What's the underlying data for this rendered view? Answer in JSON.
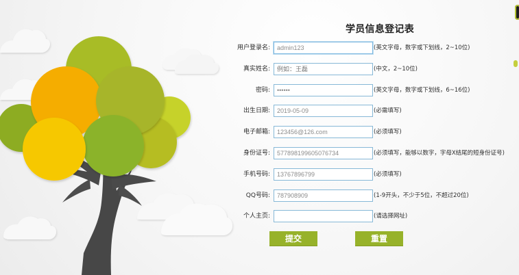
{
  "form": {
    "title": "学员信息登记表",
    "fields": [
      {
        "label": "用户登录名:",
        "value": "admin123",
        "placeholder": "",
        "hint": "(英文字母，数字或下划线，2~10位)",
        "active": true
      },
      {
        "label": "真实姓名:",
        "value": "",
        "placeholder": "例如：王磊",
        "hint": "(中文，2~10位)",
        "active": false
      },
      {
        "label": "密码:",
        "value": "••••••",
        "placeholder": "",
        "hint": "(英文字母，数字或下划线，6~16位)",
        "active": false
      },
      {
        "label": "出生日期:",
        "value": "2019-05-09",
        "placeholder": "",
        "hint": "(必需填写)",
        "active": false
      },
      {
        "label": "电子邮箱:",
        "value": "123456@126.com",
        "placeholder": "",
        "hint": "(必须填写)",
        "active": false
      },
      {
        "label": "身份证号:",
        "value": "577898199605076734",
        "placeholder": "",
        "hint": "(必须填写，能够以数字，字母X结尾的短身份证号)",
        "active": false
      },
      {
        "label": "手机号码:",
        "value": "13767896799",
        "placeholder": "",
        "hint": "(必须填写)",
        "active": false
      },
      {
        "label": "QQ号码:",
        "value": "787908909",
        "placeholder": "",
        "hint": "(1-9开头，不少于5位，不超过20位)",
        "active": false
      },
      {
        "label": "个人主页:",
        "value": "",
        "placeholder": "",
        "hint": "(请选择网址)",
        "active": false
      }
    ],
    "submit_label": "提交",
    "reset_label": "重置"
  },
  "colors": {
    "accent_green": "#97b22a",
    "input_border": "#86b8d7",
    "tree_trunk": "#3f3f3f",
    "cloud": "#f7f7f7"
  },
  "decor": {
    "tree_icon": "tree-illustration",
    "cloud_icon": "cloud"
  }
}
